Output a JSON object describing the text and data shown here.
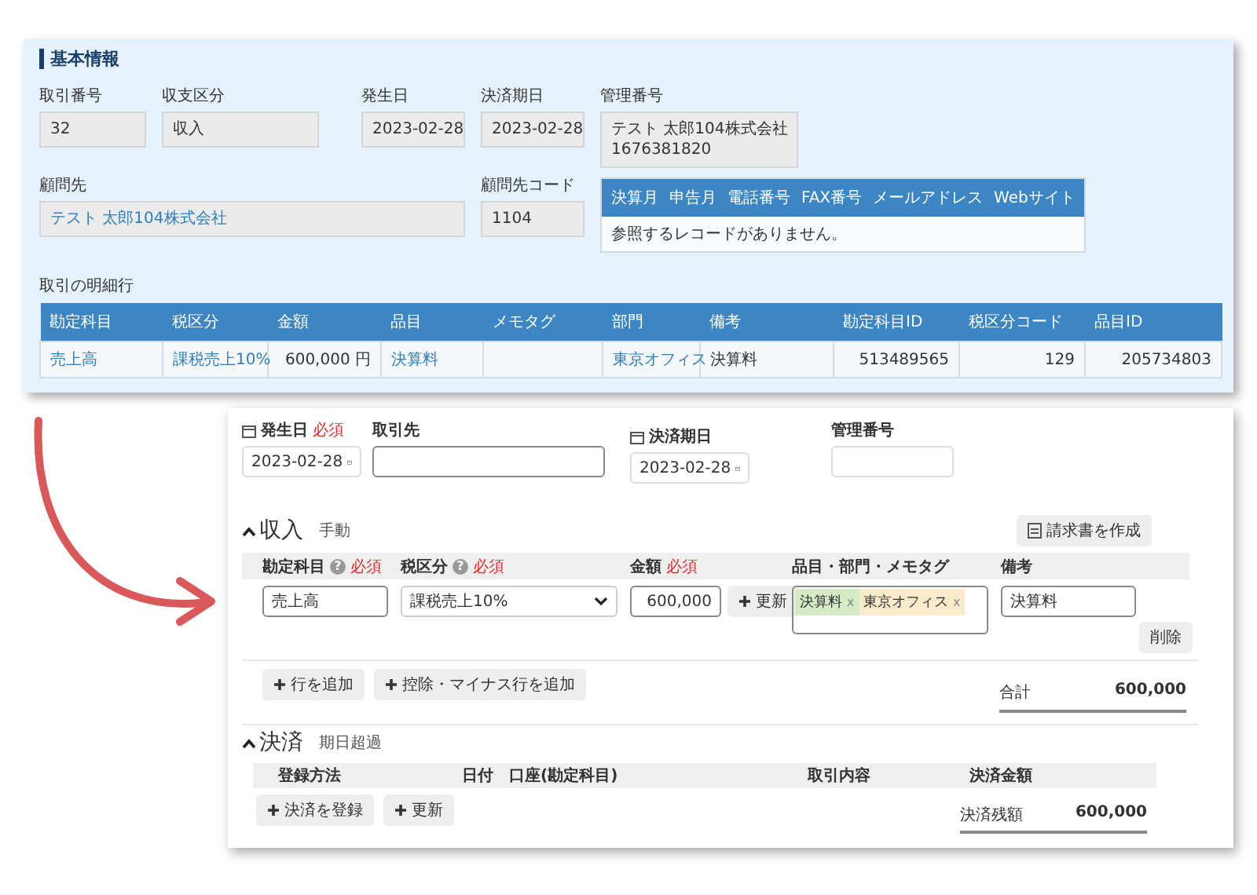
{
  "basic_info": {
    "title": "基本情報",
    "fields": [
      {
        "label": "取引番号",
        "lines": [
          "32"
        ]
      },
      {
        "label": "収支区分",
        "lines": [
          "収入"
        ]
      },
      {
        "label": "発生日",
        "lines": [
          "2023-02-28"
        ]
      },
      {
        "label": "決済期日",
        "lines": [
          "2023-02-28"
        ]
      },
      {
        "label": "管理番号",
        "lines": [
          "テスト 太郎104株式会社",
          "1676381820"
        ]
      }
    ],
    "partner": {
      "label": "顧問先",
      "value": "テスト 太郎104株式会社"
    },
    "partner_code": {
      "label": "顧問先コード",
      "value": "1104"
    },
    "contact_table": {
      "columns": [
        "決算月",
        "申告月",
        "電話番号",
        "FAX番号",
        "メールアドレス",
        "Webサイト"
      ],
      "empty_message": "参照するレコードがありません。"
    },
    "lines_title": "取引の明細行",
    "lines_table": {
      "columns": [
        "勘定科目",
        "税区分",
        "金額",
        "品目",
        "メモタグ",
        "部門",
        "備考",
        "勘定科目ID",
        "税区分コード",
        "品目ID"
      ],
      "rows": [
        {
          "cells": [
            {
              "kind": "link",
              "text": "売上高"
            },
            {
              "kind": "link",
              "text": "課税売上10%"
            },
            {
              "kind": "number",
              "text": "600,000 円"
            },
            {
              "kind": "link",
              "text": "決算料"
            },
            {
              "kind": "text"
            },
            {
              "kind": "link",
              "text": "東京オフィス"
            },
            {
              "kind": "text",
              "text": "決算料"
            },
            {
              "kind": "number",
              "text": "513489565"
            },
            {
              "kind": "number",
              "text": "129"
            },
            {
              "kind": "number",
              "text": "205734803"
            }
          ]
        }
      ]
    }
  },
  "form": {
    "fields": [
      {
        "kind": "date",
        "label": "発生日",
        "required": "必須",
        "value": "2023-02-28"
      },
      {
        "kind": "text",
        "label": "取引先"
      },
      {
        "kind": "date",
        "label": "決済期日",
        "value": "2023-02-28"
      },
      {
        "kind": "text",
        "label": "管理番号"
      }
    ],
    "income": {
      "title": "収入",
      "subtitle": "手動",
      "expanded": true,
      "invoice_button": "請求書を作成",
      "columns": [
        {
          "label": "勘定科目",
          "help": "?",
          "required": "必須"
        },
        {
          "label": "税区分",
          "help": "?",
          "required": "必須"
        },
        {
          "label": "金額",
          "required": "必須"
        },
        {
          "label": "品目・部門・メモタグ"
        },
        {
          "label": "備考"
        }
      ],
      "row": {
        "account": "売上高",
        "tax": "課税売上10%",
        "amount": "600,000",
        "update_button": "更新",
        "tags": [
          {
            "label": "決算料",
            "remove": "x",
            "color": "#d5ebc6"
          },
          {
            "label": "東京オフィス",
            "remove": "x",
            "color": "#fcebcb"
          }
        ],
        "note": "決算料",
        "delete_button": "削除"
      },
      "add_buttons": [
        "行を追加",
        "控除・マイナス行を追加"
      ],
      "total_label": "合計",
      "total": "600,000"
    },
    "settlement": {
      "title": "決済",
      "subtitle": "期日超過",
      "expanded": true,
      "columns": [
        "登録方法",
        "日付",
        "口座(勘定科目)",
        "取引内容",
        "決済金額"
      ],
      "buttons": [
        "決済を登録",
        "更新"
      ],
      "balance_label": "決済残額",
      "balance": "600,000"
    }
  }
}
